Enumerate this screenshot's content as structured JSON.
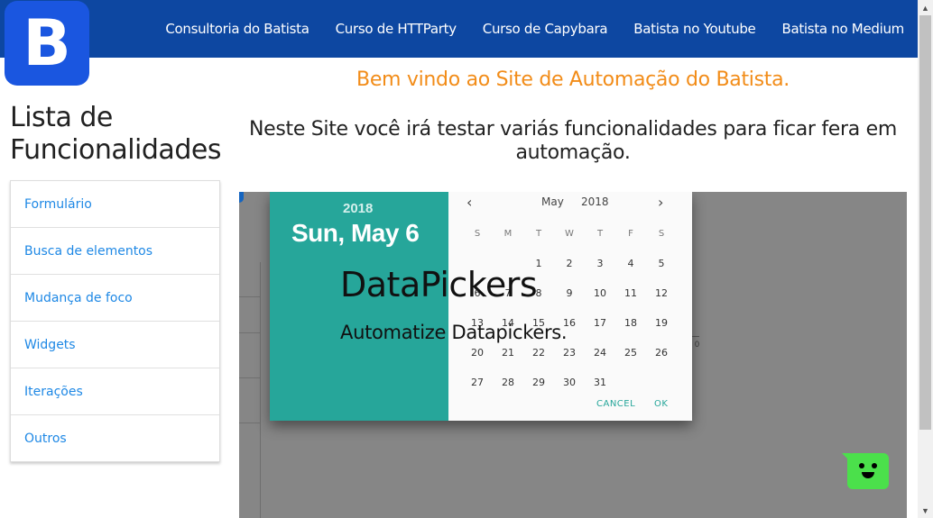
{
  "logo": {
    "letter": "B"
  },
  "nav": {
    "links": [
      "Consultoria do Batista",
      "Curso de HTTParty",
      "Curso de Capybara",
      "Batista no Youtube",
      "Batista no Medium"
    ]
  },
  "sidebar": {
    "title_line1": "Lista de",
    "title_line2": "Funcionalidades",
    "items": [
      "Formulário",
      "Busca de elementos",
      "Mudança de foco",
      "Widgets",
      "Iterações",
      "Outros"
    ]
  },
  "main": {
    "welcome": "Bem vindo ao Site de Automação do Batista.",
    "intro": "Neste Site você irá testar variás funcionalidades para ficar fera em automação."
  },
  "hero": {
    "title": "DataPickers",
    "subtitle": "Automatize Datapickers.",
    "axis_label": "0",
    "datepicker": {
      "year": "2018",
      "selected_date": "Sun, May 6",
      "month": "May",
      "cal_year": "2018",
      "prev_icon": "‹",
      "next_icon": "›",
      "weekdays": [
        "S",
        "M",
        "T",
        "W",
        "T",
        "F",
        "S"
      ],
      "days": [
        "",
        "",
        "1",
        "2",
        "3",
        "4",
        "5",
        "6",
        "7",
        "8",
        "9",
        "10",
        "11",
        "12",
        "13",
        "14",
        "15",
        "16",
        "17",
        "18",
        "19",
        "20",
        "21",
        "22",
        "23",
        "24",
        "25",
        "26",
        "27",
        "28",
        "29",
        "30",
        "31"
      ],
      "cancel": "CANCEL",
      "ok": "OK"
    }
  },
  "icons": {
    "scroll_up": "scroll-up-arrow-icon",
    "scroll_down": "scroll-down-arrow-icon",
    "chat": "chat-bot-icon"
  },
  "colors": {
    "navbar": "#0d47a1",
    "logo": "#1a56e0",
    "welcome": "#f28c18",
    "link": "#1e88e5",
    "datepicker_header": "#26a69a",
    "chat": "#4be04b"
  }
}
